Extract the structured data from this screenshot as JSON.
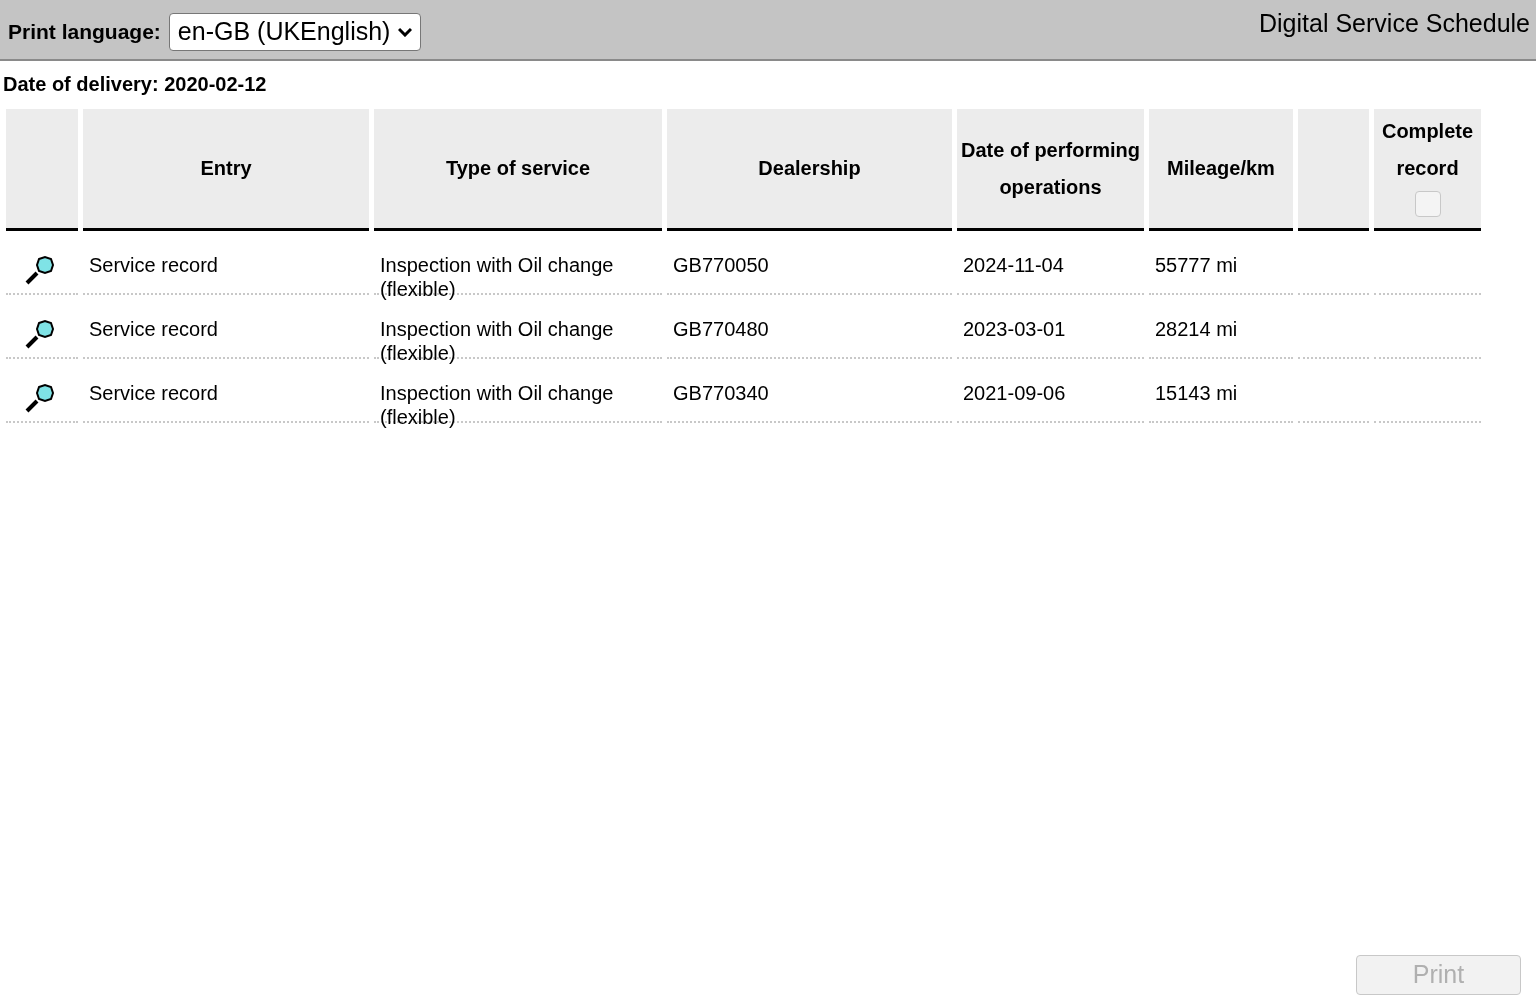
{
  "toolbar": {
    "print_language_label": "Print language:",
    "language_select": {
      "value": "en-GB (UKEnglish)"
    },
    "title": "Digital Service Schedule"
  },
  "date_of_delivery": "Date of delivery: 2020-02-12",
  "table": {
    "columns": [
      {
        "kind": "icon"
      },
      {
        "kind": "text",
        "label": "Entry"
      },
      {
        "kind": "text",
        "label": "Type of service"
      },
      {
        "kind": "text",
        "label": "Dealership"
      },
      {
        "kind": "text",
        "label": "Date of performing operations"
      },
      {
        "kind": "text",
        "label": "Mileage/km"
      },
      {
        "kind": "blank"
      },
      {
        "kind": "checkbox",
        "label": "Complete record",
        "checked": false,
        "disabled": true
      }
    ],
    "rows": [
      {
        "cells": [
          "",
          "Service record",
          "Inspection with Oil change (flexible)",
          "GB770050",
          "2024-11-04",
          "55777 mi"
        ]
      },
      {
        "cells": [
          "",
          "Service record",
          "Inspection with Oil change (flexible)",
          "GB770480",
          "2023-03-01",
          "28214 mi"
        ]
      },
      {
        "cells": [
          "",
          "Service record",
          "Inspection with Oil change (flexible)",
          "GB770340",
          "2021-09-06",
          "15143 mi"
        ]
      }
    ]
  },
  "print_button": {
    "label": "Print",
    "disabled": true
  }
}
